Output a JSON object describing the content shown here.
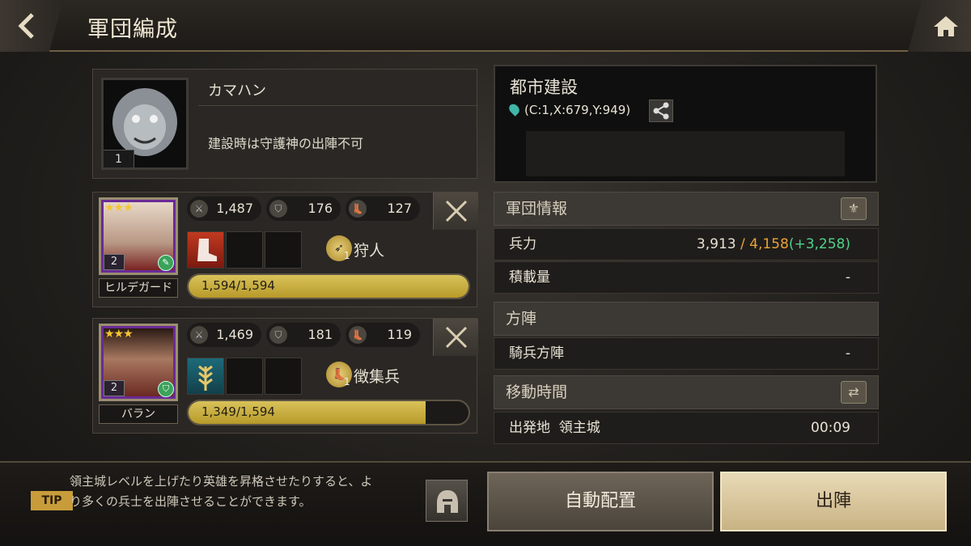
{
  "header": {
    "title": "軍団編成",
    "back_icon": "back-arrow-icon",
    "home_icon": "home-icon"
  },
  "guardian": {
    "name": "カマハン",
    "level": "1",
    "note": "建設時は守護神の出陣不可"
  },
  "heroes": [
    {
      "name": "ヒルデガード",
      "stars": "★★★",
      "level": "2",
      "attack": "1,487",
      "defense": "176",
      "speed": "127",
      "unit_name": "狩人",
      "unit_count": "1",
      "hp": "1,594/1,594",
      "hp_ratio": 1.0,
      "slot_fill": "red-boot-item"
    },
    {
      "name": "バラン",
      "stars": "★★★",
      "level": "2",
      "attack": "1,469",
      "defense": "181",
      "speed": "119",
      "unit_name": "徴集兵",
      "unit_count": "1",
      "hp": "1,349/1,594",
      "hp_ratio": 0.846,
      "slot_fill": "wheat-item"
    }
  ],
  "city": {
    "title": "都市建設",
    "coords": "(C:1,X:679,Y:949)"
  },
  "army_info": {
    "header": "軍団情報",
    "troops_label": "兵力",
    "troops_current": "3,913",
    "troops_sep": " / ",
    "troops_max": "4,158",
    "troops_bonus": "(+3,258)",
    "capacity_label": "積載量",
    "capacity_value": "-"
  },
  "formation": {
    "header": "方陣",
    "name": "騎兵方陣",
    "value": "-"
  },
  "travel": {
    "header": "移動時間",
    "origin": "出発地  領主城",
    "time": "00:09"
  },
  "footer": {
    "tip_badge": "TIP",
    "tip_text": "領主城レベルを上げたり英雄を昇格させたりすると、より多くの兵士を出陣させることができます。",
    "auto_label": "自動配置",
    "deploy_label": "出陣"
  },
  "colors": {
    "accent_gold": "#c9a84a",
    "troop_max": "#e9a23a",
    "troop_bonus": "#4fd18a",
    "hero_frame": "#6a2a96"
  }
}
